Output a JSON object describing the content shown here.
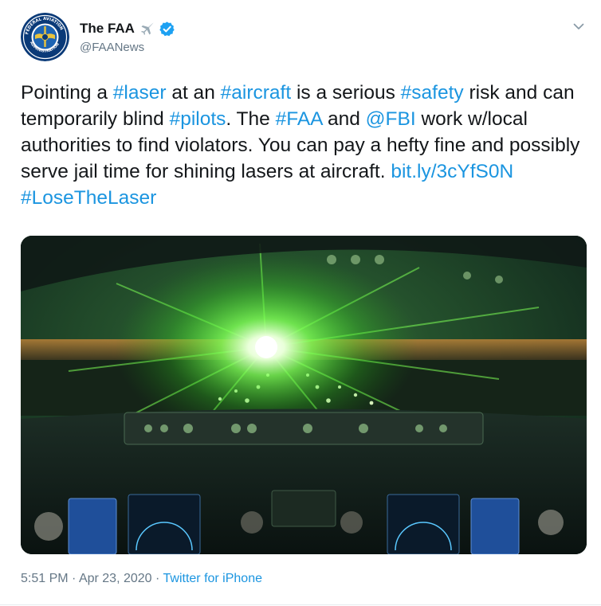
{
  "author": {
    "display_name": "The FAA",
    "handle": "@FAANews",
    "avatar_icon": "faa-seal-icon",
    "avatar_text": "FEDERAL AVIATION ADMINISTRATION",
    "badge_icons": [
      "airplane-emoji-icon",
      "verified-badge-icon"
    ]
  },
  "menu_icon": "chevron-down-icon",
  "tweet": {
    "segments": [
      {
        "t": "Pointing a ",
        "link": false
      },
      {
        "t": "#laser",
        "link": true
      },
      {
        "t": " at an ",
        "link": false
      },
      {
        "t": "#aircraft",
        "link": true
      },
      {
        "t": " is a serious ",
        "link": false
      },
      {
        "t": "#safety",
        "link": true
      },
      {
        "t": " risk and can temporarily blind ",
        "link": false
      },
      {
        "t": "#pilots",
        "link": true
      },
      {
        "t": ". The ",
        "link": false
      },
      {
        "t": "#FAA",
        "link": true
      },
      {
        "t": " and ",
        "link": false
      },
      {
        "t": "@FBI",
        "link": true
      },
      {
        "t": " work w/local authorities to find violators. You can pay a hefty fine and possibly serve jail time for shining lasers at aircraft. ",
        "link": false
      },
      {
        "t": "bit.ly/3cYfS0N",
        "link": true
      },
      {
        "t": " ",
        "link": false
      },
      {
        "t": "#LoseTheLaser",
        "link": true
      }
    ]
  },
  "media": {
    "description_icon": "cockpit-laser-photo"
  },
  "meta": {
    "time": "5:51 PM",
    "separator_1": " · ",
    "date": "Apr 23, 2020",
    "separator_2": " · ",
    "source": "Twitter for iPhone"
  },
  "colors": {
    "link": "#1b95e0",
    "secondary_text": "#657786",
    "verified": "#1da1f2",
    "laser": "#5bff3a"
  }
}
